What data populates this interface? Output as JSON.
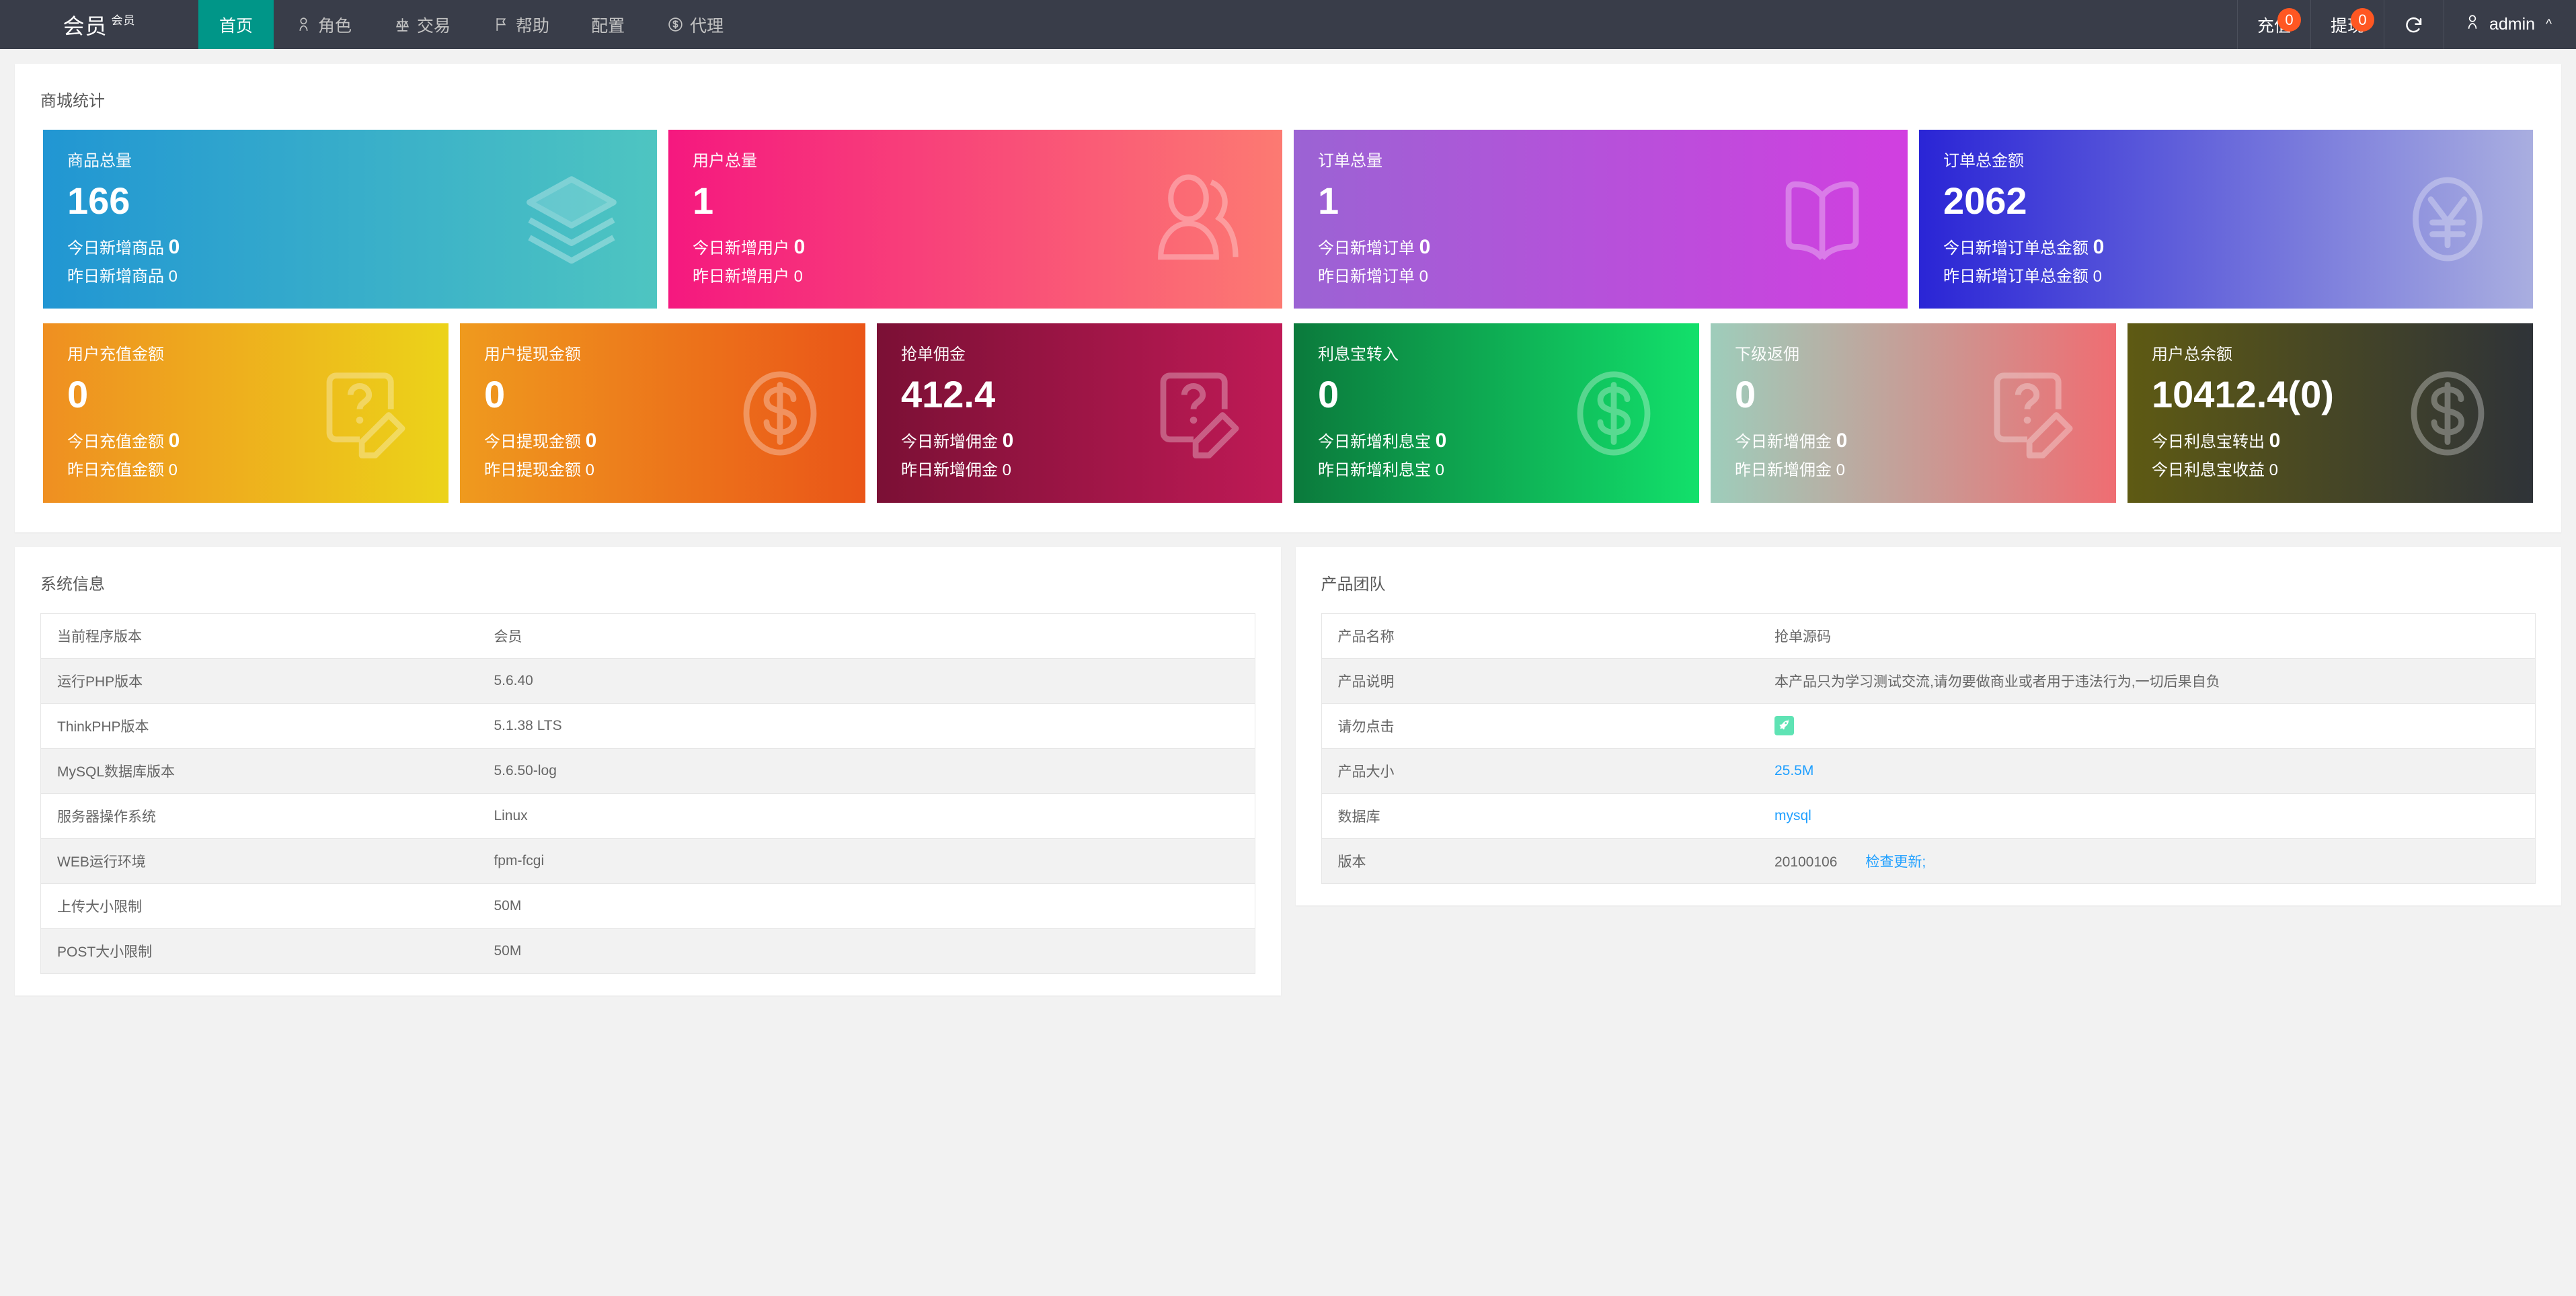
{
  "header": {
    "logo_main": "会员",
    "logo_sup": "会员",
    "nav": [
      {
        "label": "首页",
        "icon": "",
        "active": true
      },
      {
        "label": "角色",
        "icon": "person-icon",
        "active": false
      },
      {
        "label": "交易",
        "icon": "scales-icon",
        "active": false
      },
      {
        "label": "帮助",
        "icon": "flag-icon",
        "active": false
      },
      {
        "label": "配置",
        "icon": "",
        "active": false
      },
      {
        "label": "代理",
        "icon": "dollar-circle-icon",
        "active": false
      }
    ],
    "recharge_label": "充值",
    "recharge_badge": "0",
    "withdraw_label": "提现",
    "withdraw_badge": "0",
    "refresh_icon": "refresh-icon",
    "user_name": "admin",
    "user_icon": "person-icon",
    "caret_icon": "chevron-up-icon"
  },
  "stats_panel": {
    "title": "商城统计",
    "cards": [
      {
        "title": "商品总量",
        "value": "166",
        "today_label": "今日新增商品",
        "today_value": "0",
        "yesterday_label": "昨日新增商品",
        "yesterday_value": "0",
        "icon": "layers-icon",
        "gradient_from": "#2196d3",
        "gradient_to": "#4ec5c1"
      },
      {
        "title": "用户总量",
        "value": "1",
        "today_label": "今日新增用户",
        "today_value": "0",
        "yesterday_label": "昨日新增用户",
        "yesterday_value": "0",
        "icon": "user-icon",
        "gradient_from": "#f5187f",
        "gradient_to": "#fc7a72"
      },
      {
        "title": "订单总量",
        "value": "1",
        "today_label": "今日新增订单",
        "today_value": "0",
        "yesterday_label": "昨日新增订单",
        "yesterday_value": "0",
        "icon": "book-icon",
        "gradient_from": "#9b63d4",
        "gradient_to": "#d13fe0"
      },
      {
        "title": "订单总金额",
        "value": "2062",
        "today_label": "今日新增订单总金额",
        "today_value": "0",
        "yesterday_label": "昨日新增订单总金额",
        "yesterday_value": "0",
        "icon": "yen-icon",
        "gradient_from": "#2a25d6",
        "gradient_to": "#a9aee0"
      },
      {
        "title": "用户充值金额",
        "value": "0",
        "today_label": "今日充值金额",
        "today_value": "0",
        "yesterday_label": "昨日充值金额",
        "yesterday_value": "0",
        "icon": "note-pencil-icon",
        "gradient_from": "#ef8f21",
        "gradient_to": "#ecd319"
      },
      {
        "title": "用户提现金额",
        "value": "0",
        "today_label": "今日提现金额",
        "today_value": "0",
        "yesterday_label": "昨日提现金额",
        "yesterday_value": "0",
        "icon": "dollar-circle-icon",
        "gradient_from": "#ef9a1e",
        "gradient_to": "#ea5518"
      },
      {
        "title": "抢单佣金",
        "value": "412.4",
        "today_label": "今日新增佣金",
        "today_value": "0",
        "yesterday_label": "昨日新增佣金",
        "yesterday_value": "0",
        "icon": "note-pencil-icon",
        "gradient_from": "#7b1035",
        "gradient_to": "#bf1a56"
      },
      {
        "title": "利息宝转入",
        "value": "0",
        "today_label": "今日新增利息宝",
        "today_value": "0",
        "yesterday_label": "昨日新增利息宝",
        "yesterday_value": "0",
        "icon": "dollar-circle-icon",
        "gradient_from": "#0b7a3c",
        "gradient_to": "#12e06b"
      },
      {
        "title": "下级返佣",
        "value": "0",
        "today_label": "今日新增佣金",
        "today_value": "0",
        "yesterday_label": "昨日新增佣金",
        "yesterday_value": "0",
        "icon": "note-pencil-icon",
        "gradient_from": "#9ecdbb",
        "gradient_to": "#ef6d72"
      },
      {
        "title": "用户总余额",
        "value": "10412.4(0)",
        "today_label": "今日利息宝转出",
        "today_value": "0",
        "yesterday_label": "今日利息宝收益",
        "yesterday_value": "0",
        "icon": "dollar-circle-icon",
        "gradient_from": "#5e5a13",
        "gradient_to": "#2f3338"
      }
    ]
  },
  "system_info": {
    "title": "系统信息",
    "rows": [
      {
        "key": "当前程序版本",
        "value": "会员"
      },
      {
        "key": "运行PHP版本",
        "value": "5.6.40"
      },
      {
        "key": "ThinkPHP版本",
        "value": "5.1.38 LTS"
      },
      {
        "key": "MySQL数据库版本",
        "value": "5.6.50-log"
      },
      {
        "key": "服务器操作系统",
        "value": "Linux"
      },
      {
        "key": "WEB运行环境",
        "value": "fpm-fcgi"
      },
      {
        "key": "上传大小限制",
        "value": "50M"
      },
      {
        "key": "POST大小限制",
        "value": "50M"
      }
    ]
  },
  "product_team": {
    "title": "产品团队",
    "rows": [
      {
        "key": "产品名称",
        "value": "抢单源码"
      },
      {
        "key": "产品说明",
        "value": "本产品只为学习测试交流,请勿要做商业或者用于违法行为,一切后果自负"
      },
      {
        "key": "请勿点击",
        "value": ""
      },
      {
        "key": "产品大小",
        "value": "25.5M"
      },
      {
        "key": "数据库",
        "value": "mysql"
      },
      {
        "key": "版本",
        "value": "20100106"
      }
    ],
    "rocket_icon": "rocket-icon",
    "check_update_label": "检查更新;"
  },
  "colors": {
    "header_bg": "#393D49",
    "accent": "#009688",
    "page_bg": "#f2f2f2",
    "badge": "#FF5722",
    "link": "#1E9FFF"
  }
}
